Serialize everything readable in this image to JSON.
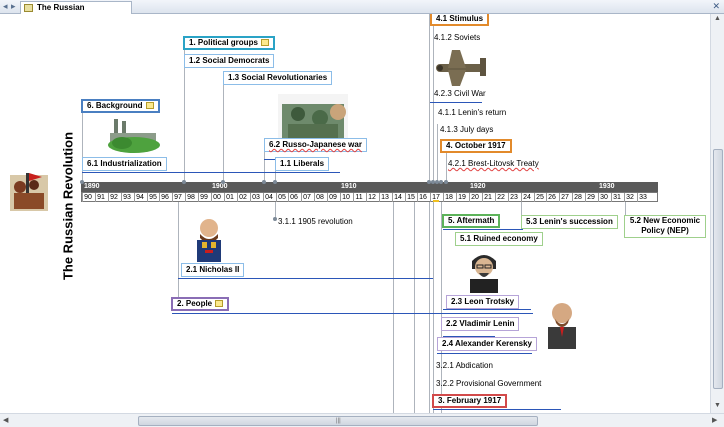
{
  "tab": {
    "nav_left": "◂",
    "nav_right": "▸",
    "title": "The Russian Revolution.mvdx",
    "close": "✕"
  },
  "title": "The Russian Revolution",
  "ruler": {
    "decades": [
      "1890",
      "1900",
      "1910",
      "1920",
      "1930"
    ],
    "years": [
      "90",
      "91",
      "92",
      "93",
      "94",
      "95",
      "96",
      "97",
      "98",
      "99",
      "00",
      "01",
      "02",
      "03",
      "04",
      "05",
      "06",
      "07",
      "08",
      "09",
      "10",
      "11",
      "12",
      "13",
      "14",
      "15",
      "16",
      "17",
      "18",
      "19",
      "20",
      "21",
      "22",
      "23",
      "24",
      "25",
      "26",
      "27",
      "28",
      "29",
      "30",
      "31",
      "32",
      "33"
    ]
  },
  "topics": {
    "political_groups": "1.  Political groups",
    "social_democrats": "1.2  Social Democrats",
    "social_revolutionaries": "1.3  Social Revolutionaries",
    "liberals": "1.1  Liberals",
    "background": "6.  Background",
    "industrialization": "6.1  Industrialization",
    "russo_japanese": "6.2  Russo-Japanese war",
    "revolution_1905": "3.1.1   1905 revolution",
    "nicholas": "2.1  Nicholas II",
    "people": "2.  People",
    "stimulus": "4.1  Stimulus",
    "soviets": "4.1.2  Soviets",
    "civil_war": "4.2.3  Civil War",
    "lenins_return": "4.1.1   Lenin's return",
    "july_days": "4.1.3  July days",
    "october": "4.  October 1917",
    "brest": "4.2.1   Brest-Litovsk Treaty",
    "aftermath": "5.  Aftermath",
    "lenins_succession": "5.3   Lenin's succession",
    "nep": "5.2  New Economic Policy (NEP)",
    "ruined_economy": "5.1  Ruined economy",
    "trotsky": "2.3  Leon Trotsky",
    "lenin": "2.2  Vladimir Lenin",
    "kerensky": "2.4  Alexander Kerensky",
    "abdication": "3.2.1   Abdication",
    "provisional": "3.2.2   Provisional Government",
    "february": "3.  February 1917"
  },
  "icons": {
    "note": "note-icon",
    "airplane": "airplane-image",
    "factory": "factory-image",
    "soldiers": "soldiers-image",
    "tsar": "tsar-portrait",
    "trotsky": "trotsky-portrait",
    "lenin": "lenin-portrait",
    "crowd": "revolution-crowd-image"
  }
}
